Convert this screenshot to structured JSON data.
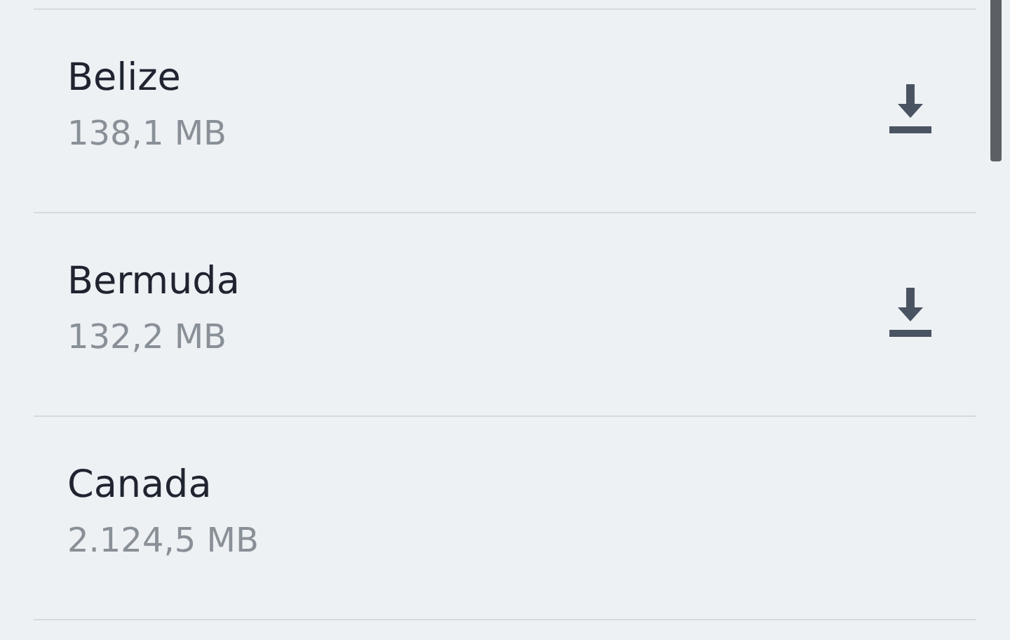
{
  "regions": [
    {
      "name": "Belize",
      "size": "138,1 MB",
      "download_available": true
    },
    {
      "name": "Bermuda",
      "size": "132,2 MB",
      "download_available": true
    },
    {
      "name": "Canada",
      "size": "2.124,5 MB",
      "download_available": false
    }
  ]
}
